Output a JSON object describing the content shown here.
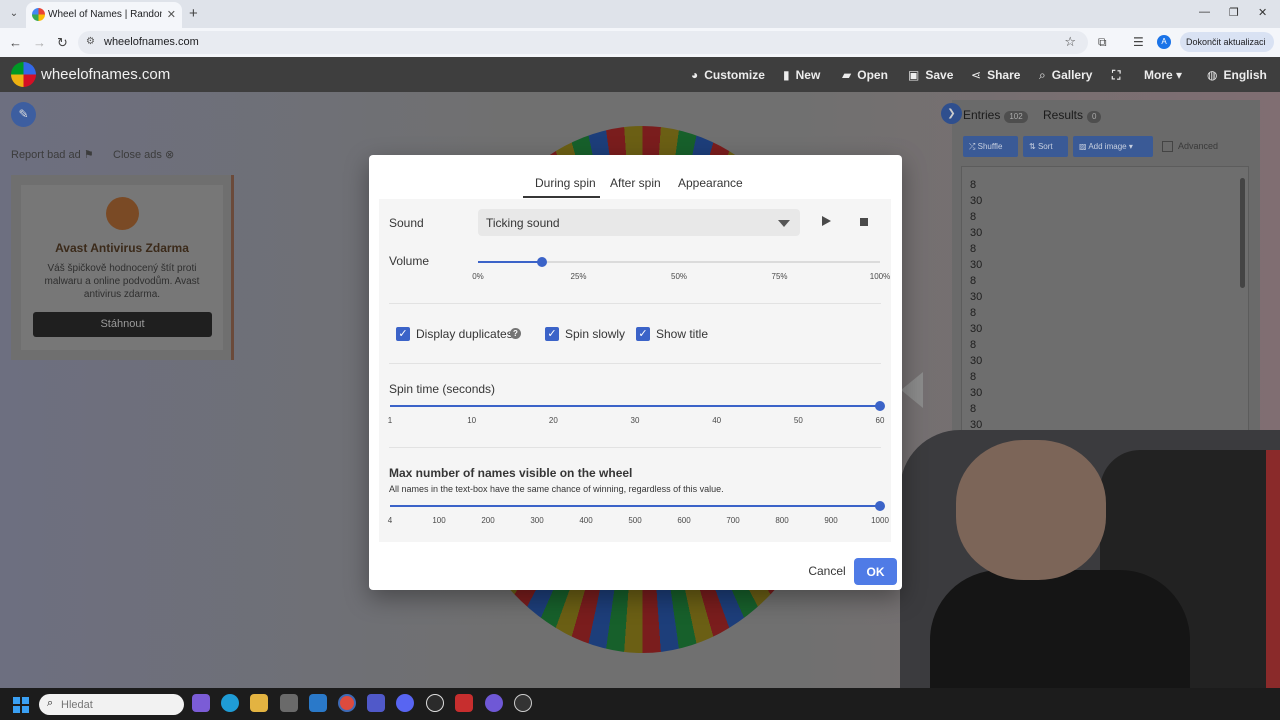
{
  "browser": {
    "tab_title": "Wheel of Names | Random name picker",
    "url": "wheelofnames.com",
    "update_button": "Dokončit aktualizaci",
    "profile_initial": "A"
  },
  "site": {
    "logo_text": "wheelofnames.com",
    "nav": [
      "Customize",
      "New",
      "Open",
      "Save",
      "Share",
      "Gallery",
      "More",
      "English"
    ]
  },
  "ad": {
    "report": "Report bad ad",
    "close": "Close ads",
    "title": "Avast Antivirus Zdarma",
    "text": "Váš špičkově hodnocený štít proti malwaru a online podvodům. Avast antivirus zdarma.",
    "button": "Stáhnout"
  },
  "panel": {
    "entries_label": "Entries",
    "entries_count": "102",
    "results_label": "Results",
    "results_count": "0",
    "shuffle": "Shuffle",
    "sort": "Sort",
    "add_image": "Add image",
    "advanced": "Advanced",
    "entries": [
      "8",
      "30",
      "8",
      "30",
      "8",
      "30",
      "8",
      "30",
      "8",
      "30",
      "8",
      "30",
      "8",
      "30",
      "8",
      "30",
      "8"
    ]
  },
  "modal": {
    "tabs": [
      "During spin",
      "After spin",
      "Appearance"
    ],
    "active_tab": "During spin",
    "sound_label": "Sound",
    "sound_value": "Ticking sound",
    "volume_label": "Volume",
    "volume_value": 0.16,
    "volume_ticks": [
      "0%",
      "25%",
      "50%",
      "75%",
      "100%"
    ],
    "checkboxes": [
      {
        "label": "Display duplicates",
        "checked": true
      },
      {
        "label": "Spin slowly",
        "checked": true
      },
      {
        "label": "Show title",
        "checked": true
      }
    ],
    "spin_time_label": "Spin time (seconds)",
    "spin_time_value": 60,
    "spin_time_ticks": [
      "1",
      "10",
      "20",
      "30",
      "40",
      "50",
      "60"
    ],
    "max_names_title": "Max number of names visible on the wheel",
    "max_names_desc": "All names in the text-box have the same chance of winning, regardless of this value.",
    "max_names_value": 1000,
    "max_names_ticks": [
      "4",
      "100",
      "200",
      "300",
      "400",
      "500",
      "600",
      "700",
      "800",
      "900",
      "1000"
    ],
    "cancel": "Cancel",
    "ok": "OK"
  },
  "taskbar": {
    "search_placeholder": "Hledat"
  },
  "colors": {
    "accent": "#3b63c8",
    "ok_button": "#4f7be6",
    "navbar": "#3e3e3e"
  }
}
